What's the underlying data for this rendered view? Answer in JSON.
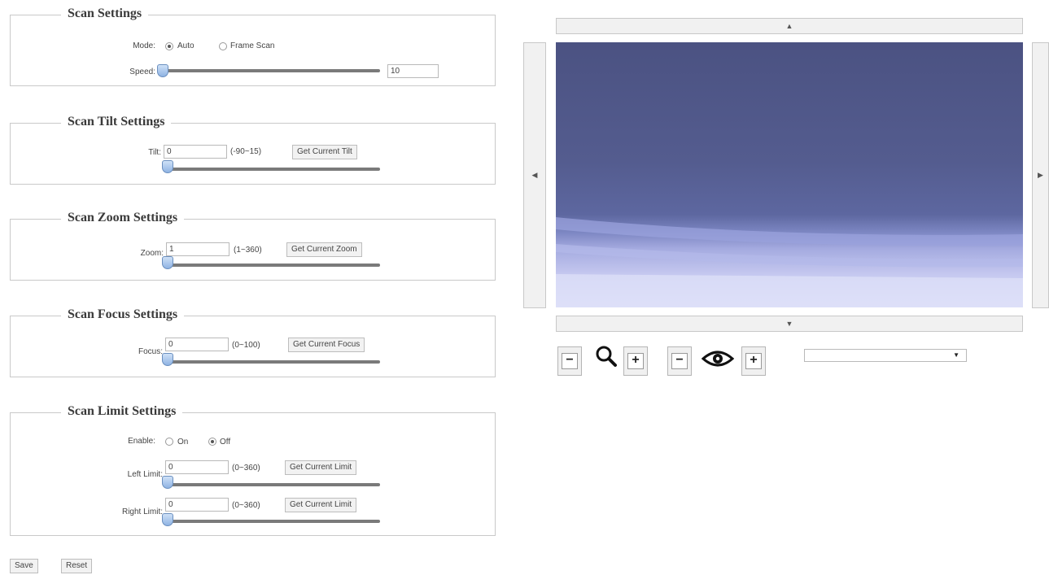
{
  "scan_settings": {
    "title": "Scan Settings",
    "mode_label": "Mode:",
    "mode_options": [
      "Auto",
      "Frame Scan"
    ],
    "mode_selected": "Auto",
    "speed_label": "Speed:",
    "speed_value": "10"
  },
  "tilt_settings": {
    "title": "Scan Tilt Settings",
    "label": "Tilt:",
    "value": "0",
    "range": "(-90~15)",
    "button": "Get Current Tilt"
  },
  "zoom_settings": {
    "title": "Scan Zoom Settings",
    "label": "Zoom:",
    "value": "1",
    "range": "(1~360)",
    "button": "Get Current Zoom"
  },
  "focus_settings": {
    "title": "Scan Focus Settings",
    "label": "Focus:",
    "value": "0",
    "range": "(0~100)",
    "button": "Get Current Focus"
  },
  "limit_settings": {
    "title": "Scan Limit Settings",
    "enable_label": "Enable:",
    "enable_options": [
      "On",
      "Off"
    ],
    "enable_selected": "Off",
    "left_label": "Left Limit:",
    "left_value": "0",
    "left_range": "(0~360)",
    "left_button": "Get Current Limit",
    "right_label": "Right Limit:",
    "right_value": "0",
    "right_range": "(0~360)",
    "right_button": "Get Current Limit"
  },
  "actions": {
    "save": "Save",
    "reset": "Reset"
  },
  "camera": {
    "up_arrow": "▲",
    "down_arrow": "▼",
    "left_arrow": "◀",
    "right_arrow": "▶",
    "zoom_out": "−",
    "zoom_in": "+",
    "focus_out": "−",
    "focus_in": "+",
    "preset_value": ""
  }
}
